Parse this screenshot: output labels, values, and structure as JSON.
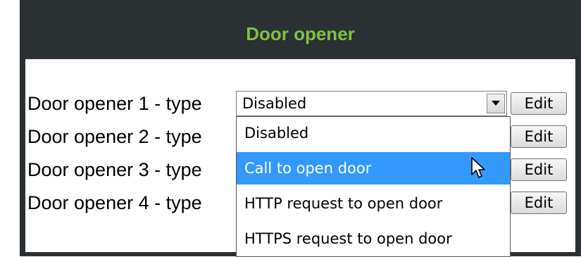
{
  "panel": {
    "title": "Door opener"
  },
  "rows": [
    {
      "label": "Door opener 1 - type",
      "edit_label": "Edit"
    },
    {
      "label": "Door opener 2 - type",
      "edit_label": "Edit"
    },
    {
      "label": "Door opener 3 - type",
      "edit_label": "Edit"
    },
    {
      "label": "Door opener 4 - type",
      "edit_label": "Edit"
    }
  ],
  "select": {
    "value": "Disabled",
    "options": [
      {
        "label": "Disabled"
      },
      {
        "label": "Call to open door",
        "highlighted": true
      },
      {
        "label": "HTTP request to open door"
      },
      {
        "label": "HTTPS request to open door"
      }
    ]
  },
  "colors": {
    "panel_background": "#2b3033",
    "title_text": "#7dc241",
    "highlight": "#3399ff"
  },
  "icons": {
    "dropdown_arrow": "chevron-down-icon",
    "cursor": "mouse-pointer-icon"
  }
}
